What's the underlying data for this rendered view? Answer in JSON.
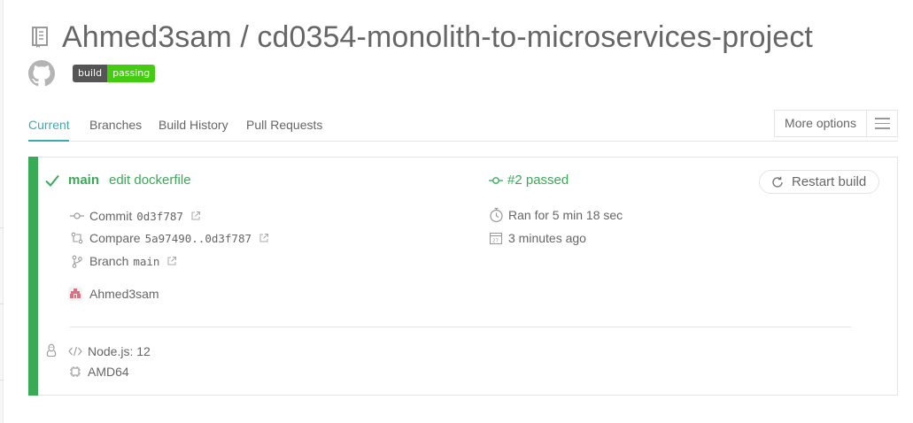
{
  "header": {
    "title": "Ahmed3sam / cd0354-monolith-to-microservices-project",
    "repo_icon": "repo-book-icon",
    "github_icon": "github-octocat-icon"
  },
  "badge": {
    "left": "build",
    "right": "passing",
    "left_color": "#555555",
    "right_color": "#44cc11"
  },
  "tabs": [
    {
      "label": "Current",
      "active": true
    },
    {
      "label": "Branches",
      "active": false
    },
    {
      "label": "Build History",
      "active": false
    },
    {
      "label": "Pull Requests",
      "active": false
    }
  ],
  "more_options": {
    "label": "More options",
    "icon": "hamburger-menu-icon"
  },
  "build": {
    "status_color": "#39aa56",
    "branch": "main",
    "message": "edit dockerfile",
    "number_status": "#2 passed",
    "restart_label": "Restart build",
    "commit": {
      "label": "Commit",
      "value": "0d3f787"
    },
    "compare": {
      "label": "Compare",
      "value": "5a97490..0d3f787"
    },
    "branch_row": {
      "label": "Branch",
      "value": "main"
    },
    "author": "Ahmed3sam",
    "duration": "Ran for 5 min 18 sec",
    "finished": "3 minutes ago",
    "language": "Node.js: 12",
    "arch": "AMD64"
  },
  "colors": {
    "accent": "#3eaaaf",
    "passed": "#39aa56",
    "text": "#666666",
    "border": "#e4e4e4"
  }
}
